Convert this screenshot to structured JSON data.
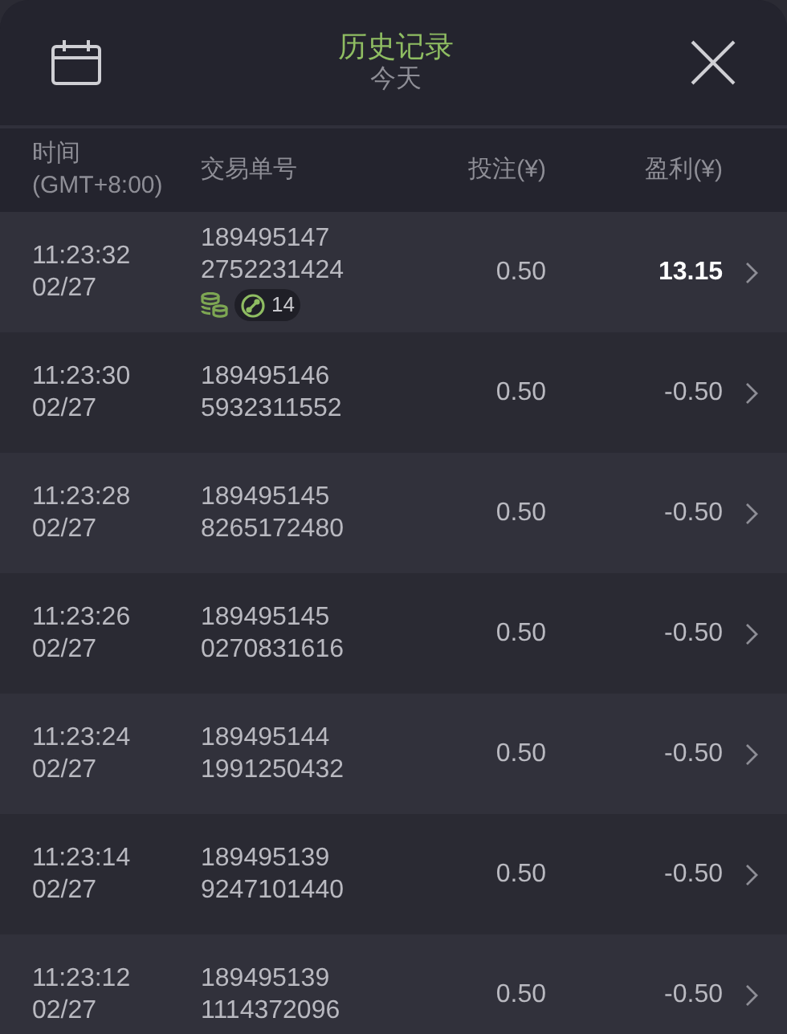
{
  "header": {
    "title": "历史记录",
    "subtitle": "今天"
  },
  "columns": [
    {
      "label": "时间\n(GMT+8:00)"
    },
    {
      "label": "交易单号"
    },
    {
      "label": "投注(¥)"
    },
    {
      "label": "盈利(¥)"
    }
  ],
  "rows": [
    {
      "time": "11:23:32",
      "date": "02/27",
      "order_1": "189495147",
      "order_2": "2752231424",
      "bet": "0.50",
      "profit": "13.15",
      "kind": "win",
      "bonus": {
        "count": "14"
      }
    },
    {
      "time": "11:23:30",
      "date": "02/27",
      "order_1": "189495146",
      "order_2": "5932311552",
      "bet": "0.50",
      "profit": "-0.50",
      "kind": "loss"
    },
    {
      "time": "11:23:28",
      "date": "02/27",
      "order_1": "189495145",
      "order_2": "8265172480",
      "bet": "0.50",
      "profit": "-0.50",
      "kind": "loss"
    },
    {
      "time": "11:23:26",
      "date": "02/27",
      "order_1": "189495145",
      "order_2": "0270831616",
      "bet": "0.50",
      "profit": "-0.50",
      "kind": "loss"
    },
    {
      "time": "11:23:24",
      "date": "02/27",
      "order_1": "189495144",
      "order_2": "1991250432",
      "bet": "0.50",
      "profit": "-0.50",
      "kind": "loss"
    },
    {
      "time": "11:23:14",
      "date": "02/27",
      "order_1": "189495139",
      "order_2": "9247101440",
      "bet": "0.50",
      "profit": "-0.50",
      "kind": "loss"
    },
    {
      "time": "11:23:12",
      "date": "02/27",
      "order_1": "189495139",
      "order_2": "1114372096",
      "bet": "0.50",
      "profit": "-0.50",
      "kind": "loss"
    }
  ]
}
